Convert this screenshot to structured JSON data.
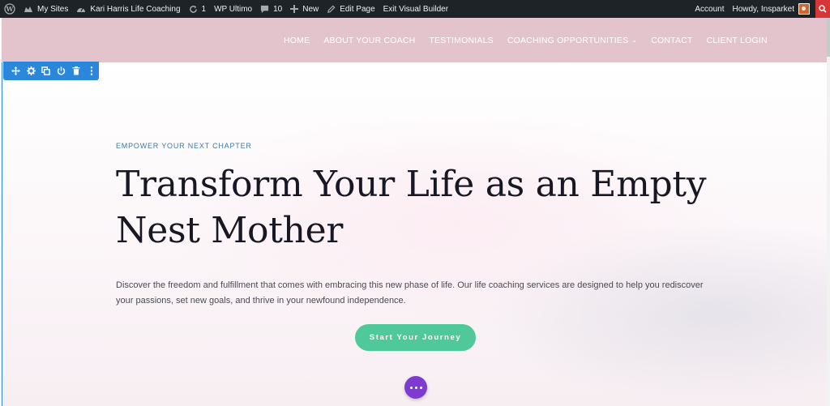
{
  "admin_bar": {
    "my_sites": "My Sites",
    "site_name": "Kari Harris Life Coaching",
    "updates_count": "1",
    "wp_ultimo": "WP Ultimo",
    "comments_count": "10",
    "new": "New",
    "edit_page": "Edit Page",
    "exit_builder": "Exit Visual Builder",
    "account": "Account",
    "howdy": "Howdy, Insparket"
  },
  "nav": {
    "items": [
      {
        "label": "HOME"
      },
      {
        "label": "ABOUT YOUR COACH"
      },
      {
        "label": "TESTIMONIALS"
      },
      {
        "label": "COACHING OPPORTUNITIES"
      },
      {
        "label": "CONTACT"
      },
      {
        "label": "CLIENT LOGIN"
      }
    ]
  },
  "hero": {
    "kicker": "EMPOWER YOUR NEXT CHAPTER",
    "headline": "Transform Your Life as an Empty Nest Mother",
    "lede": "Discover the freedom and fulfillment that comes with embracing this new phase of life. Our life coaching services are designed to help you rediscover your passions, set new goals, and thrive in your newfound independence.",
    "cta": "Start Your Journey"
  },
  "colors": {
    "admin_bar": "#1d2327",
    "header": "#e4c4cc",
    "divi_blue": "#2b87da",
    "cta": "#4fc99a",
    "more": "#7e3bd0"
  },
  "icons": {
    "divi_tools": [
      "move-icon",
      "settings-icon",
      "duplicate-icon",
      "power-icon",
      "trash-icon",
      "more-vertical-icon"
    ]
  }
}
